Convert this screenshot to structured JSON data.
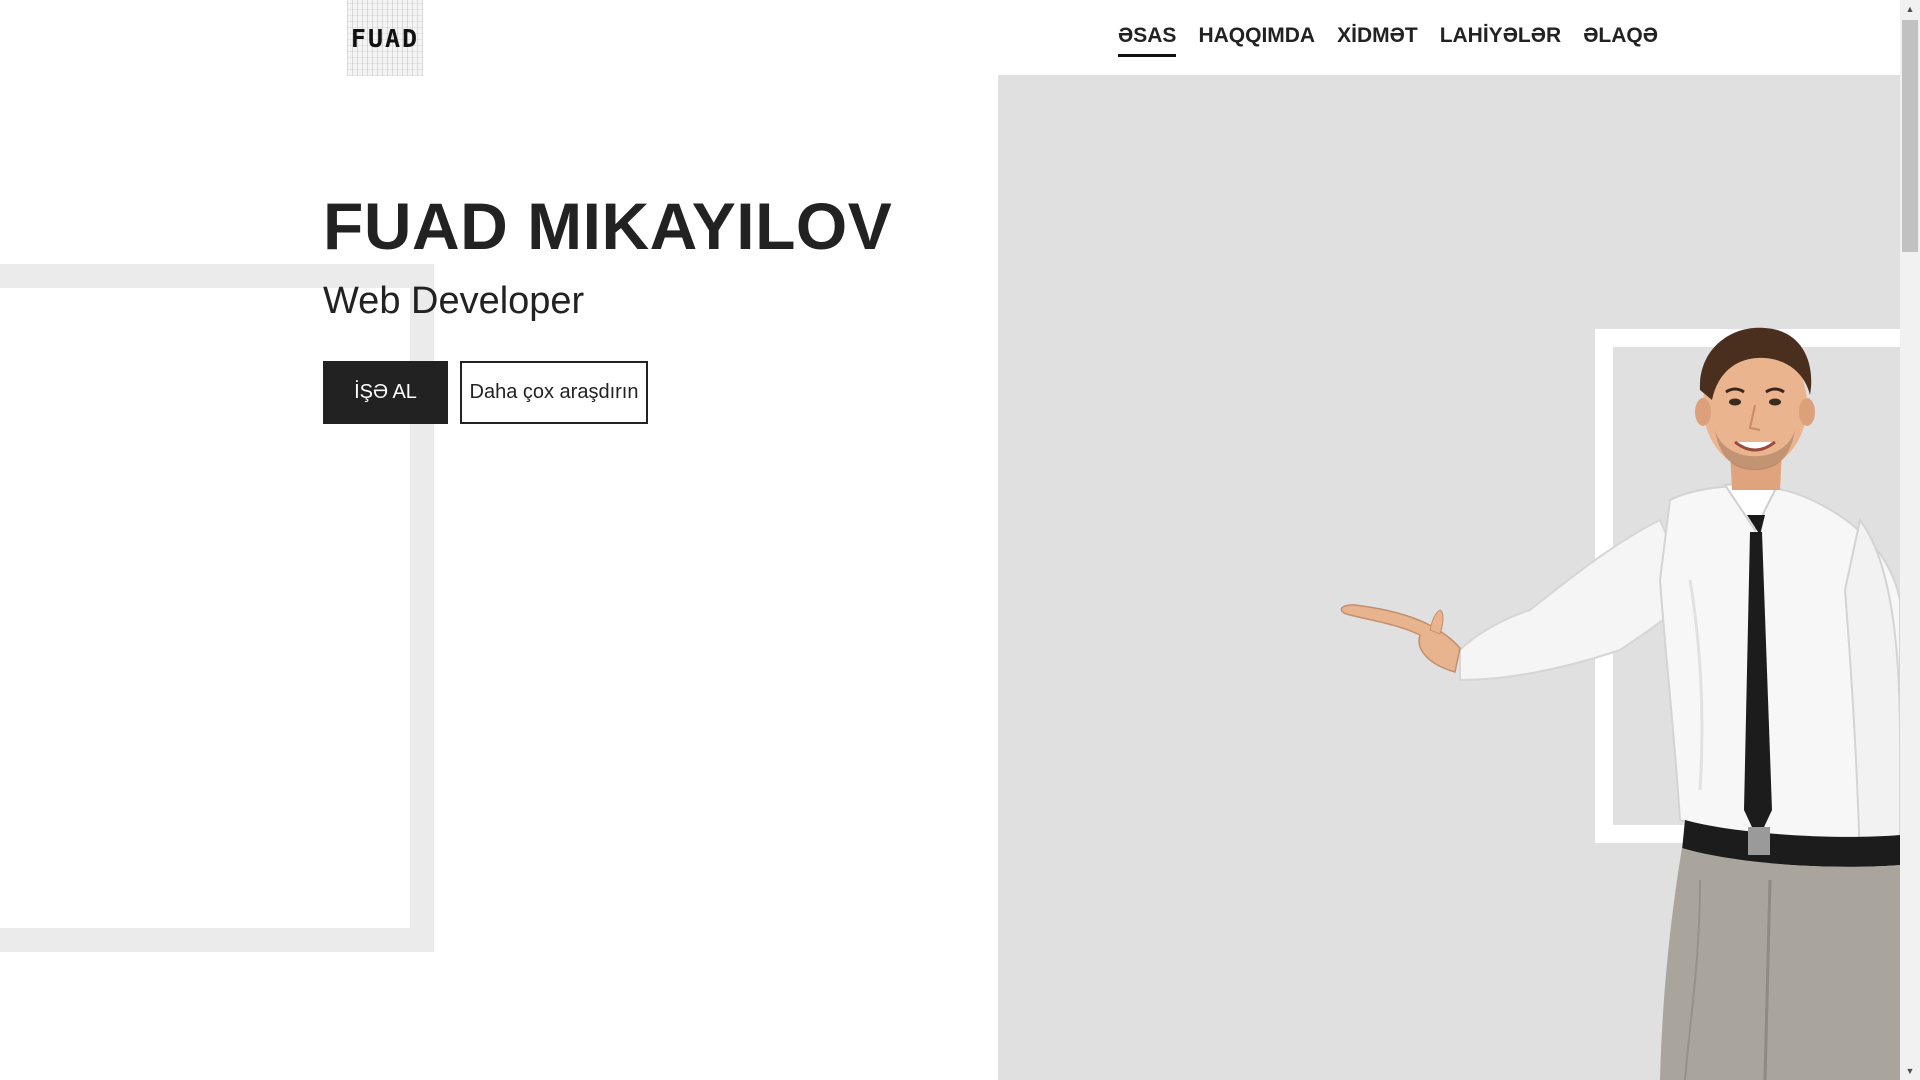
{
  "header": {
    "logo_text": "FUAD",
    "nav": [
      {
        "label": "ƏSAS",
        "active": true
      },
      {
        "label": "HAQQIMDA",
        "active": false
      },
      {
        "label": "XİDMƏT",
        "active": false
      },
      {
        "label": "LAHİYƏLƏR",
        "active": false
      },
      {
        "label": "ƏLAQƏ",
        "active": false
      }
    ]
  },
  "hero": {
    "name": "FUAD MIKAYILOV",
    "role": "Web Developer",
    "primary_button": "İŞƏ AL",
    "secondary_button": "Daha çox araşdırın"
  },
  "image": {
    "icon": "person-presenting-illustration"
  },
  "colors": {
    "text": "#222222",
    "panel_bg": "#e0e0e0",
    "frame": "#ebebeb",
    "button_dark": "#222222"
  }
}
